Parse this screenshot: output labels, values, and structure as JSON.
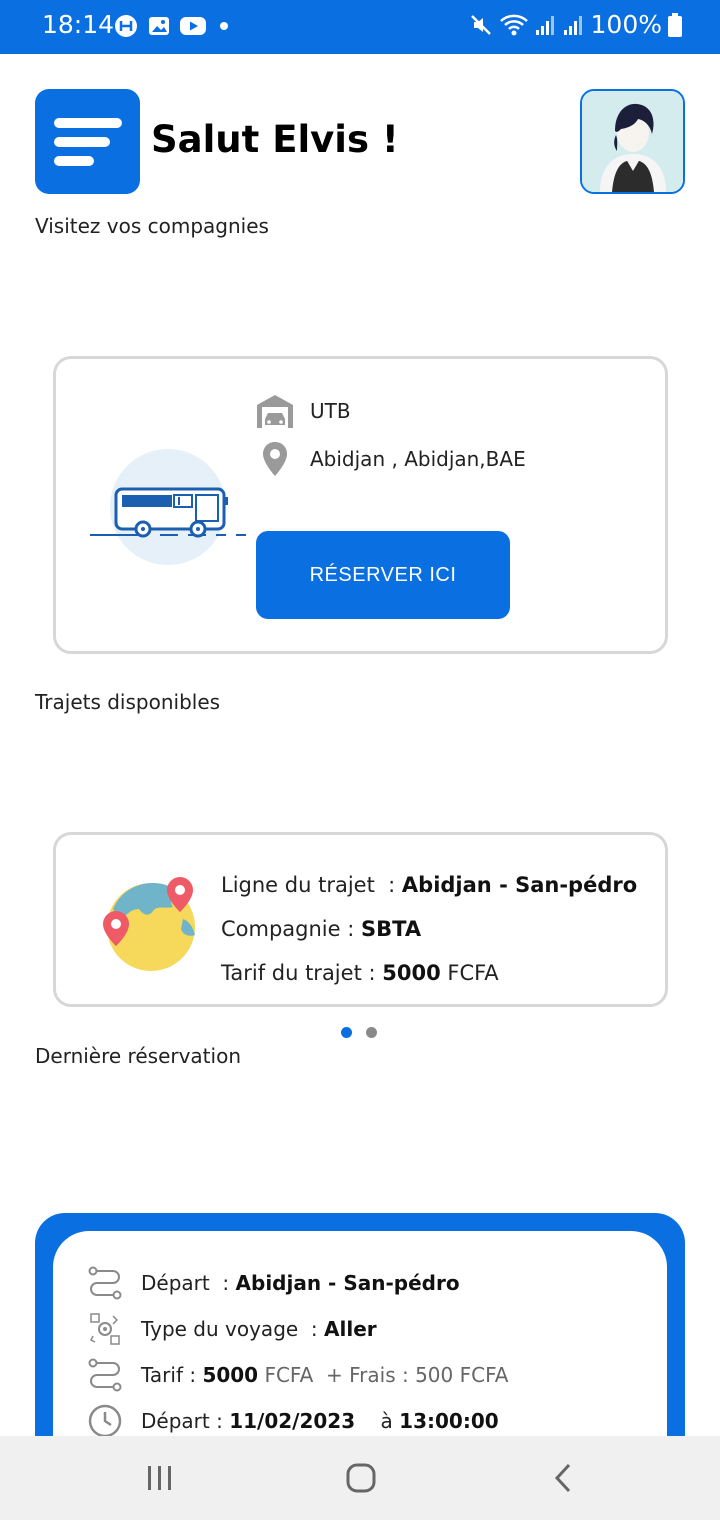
{
  "status_bar": {
    "time": "18:14",
    "battery": "100%"
  },
  "header": {
    "greeting": "Salut Elvis !"
  },
  "sections": {
    "companies_label": "Visitez vos compagnies",
    "trips_label": "Trajets disponibles",
    "last_reservation_label": "Dernière réservation"
  },
  "company_card": {
    "name": "UTB",
    "location": "Abidjan , Abidjan,BAE",
    "reserve_label": "RÉSERVER ICI"
  },
  "trip_card": {
    "line_label": "Ligne du trajet  : ",
    "line_value": "Abidjan - San-pédro",
    "company_label": "Compagnie : ",
    "company_value": "SBTA",
    "fare_label": "Tarif du trajet : ",
    "fare_value": "5000",
    "fare_currency": " FCFA"
  },
  "carousel": {
    "active_index": 0,
    "count": 2
  },
  "last_reservation": {
    "departure_label": "Départ  : ",
    "departure_value": "Abidjan - San-pédro",
    "trip_type_label": "Type du voyage  : ",
    "trip_type_value": "Aller",
    "fare_label": "Tarif : ",
    "fare_value": "5000",
    "fare_currency": " FCFA",
    "fees_text": "  + Frais : 500 FCFA",
    "date_label": "Départ : ",
    "date_value": "11/02/2023",
    "time_sep": "    à ",
    "time_value": "13:00:00"
  },
  "colors": {
    "accent": "#0a6fe0",
    "card_border": "#d7d7d7",
    "dot_inactive": "#8a8a8a"
  },
  "icons": {
    "status_left": [
      "app-notification-icon",
      "gallery-icon",
      "youtube-icon",
      "dot-icon"
    ],
    "status_right": [
      "mute-icon",
      "wifi-icon",
      "signal-icon",
      "signal-icon",
      "battery-icon"
    ],
    "nav": [
      "recents-icon",
      "home-icon",
      "back-icon"
    ]
  }
}
